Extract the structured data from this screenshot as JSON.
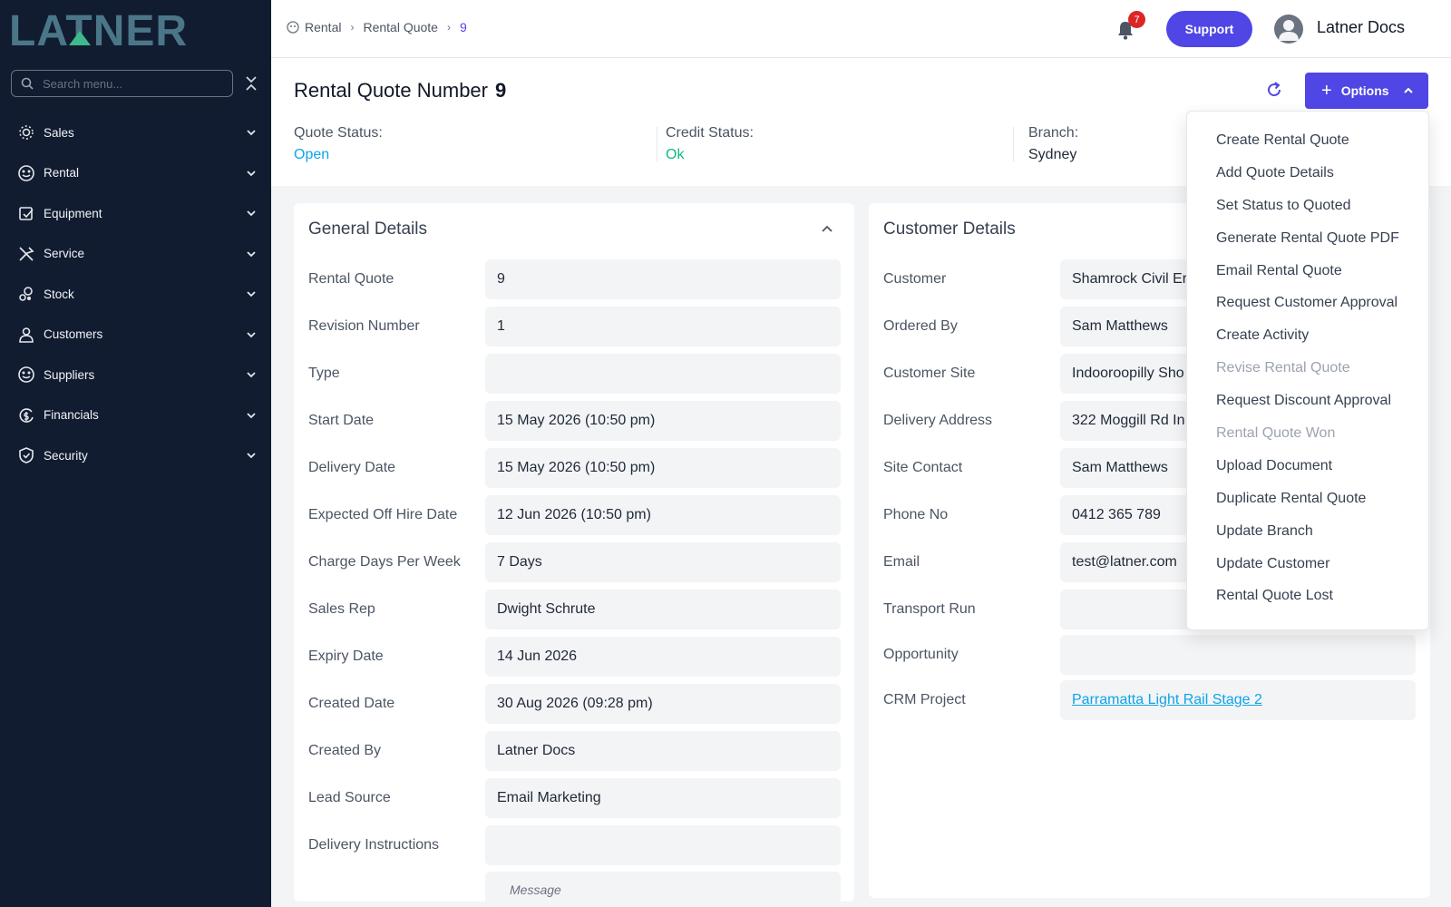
{
  "brand": {
    "logo_text": "LATNER",
    "accent": "#4f46e5",
    "sidebar_bg": "#111c31"
  },
  "sidebar": {
    "search_placeholder": "Search menu...",
    "items": [
      {
        "label": "Sales",
        "icon": "sales-icon"
      },
      {
        "label": "Rental",
        "icon": "rental-icon"
      },
      {
        "label": "Equipment",
        "icon": "equipment-icon"
      },
      {
        "label": "Service",
        "icon": "service-icon"
      },
      {
        "label": "Stock",
        "icon": "stock-icon"
      },
      {
        "label": "Customers",
        "icon": "customers-icon"
      },
      {
        "label": "Suppliers",
        "icon": "suppliers-icon"
      },
      {
        "label": "Financials",
        "icon": "financials-icon"
      },
      {
        "label": "Security",
        "icon": "security-icon"
      }
    ]
  },
  "topbar": {
    "breadcrumb": [
      "Rental",
      "Rental Quote",
      "9"
    ],
    "notification_count": "7",
    "support_label": "Support",
    "user_name": "Latner Docs"
  },
  "header": {
    "title": "Rental Quote Number",
    "number": "9",
    "options_label": "Options",
    "stats": [
      {
        "label": "Quote Status:",
        "value": "Open",
        "color": "#0ea5e9"
      },
      {
        "label": "Credit Status:",
        "value": "Ok",
        "color": "#10b981"
      },
      {
        "label": "Branch:",
        "value": "Sydney",
        "color": "#1f2937"
      }
    ]
  },
  "general": {
    "title": "General Details",
    "rows": [
      {
        "label": "Rental Quote",
        "value": "9"
      },
      {
        "label": "Revision Number",
        "value": "1"
      },
      {
        "label": "Type",
        "value": ""
      },
      {
        "label": "Start Date",
        "value": "15 May 2026 (10:50 pm)"
      },
      {
        "label": "Delivery Date",
        "value": "15 May 2026 (10:50 pm)"
      },
      {
        "label": "Expected Off Hire Date",
        "value": "12 Jun 2026 (10:50 pm)"
      },
      {
        "label": "Charge Days Per Week",
        "value": "7 Days"
      },
      {
        "label": "Sales Rep",
        "value": "Dwight Schrute"
      },
      {
        "label": "Expiry Date",
        "value": "14 Jun 2026"
      },
      {
        "label": "Created Date",
        "value": "30 Aug 2026 (09:28 pm)"
      },
      {
        "label": "Created By",
        "value": "Latner Docs"
      },
      {
        "label": "Lead Source",
        "value": "Email Marketing"
      },
      {
        "label": "Delivery Instructions",
        "value": ""
      }
    ],
    "message_placeholder": "Message"
  },
  "customer": {
    "title": "Customer Details",
    "rows": [
      {
        "label": "Customer",
        "value": "Shamrock Civil Er"
      },
      {
        "label": "Ordered By",
        "value": "Sam Matthews"
      },
      {
        "label": "Customer Site",
        "value": "Indooroopilly Sho"
      },
      {
        "label": "Delivery Address",
        "value": "322 Moggill Rd In"
      },
      {
        "label": "Site Contact",
        "value": "Sam Matthews"
      },
      {
        "label": "Phone No",
        "value": "0412 365 789"
      },
      {
        "label": "Email",
        "value": "test@latner.com"
      },
      {
        "label": "Transport Run",
        "value": ""
      },
      {
        "label": "Opportunity",
        "value": ""
      },
      {
        "label": "CRM Project",
        "value": "Parramatta Light Rail Stage 2"
      }
    ]
  },
  "options_menu": [
    {
      "label": "Create Rental Quote",
      "disabled": false
    },
    {
      "label": "Add Quote Details",
      "disabled": false
    },
    {
      "label": "Set Status to Quoted",
      "disabled": false
    },
    {
      "label": "Generate Rental Quote PDF",
      "disabled": false
    },
    {
      "label": "Email Rental Quote",
      "disabled": false
    },
    {
      "label": "Request Customer Approval",
      "disabled": false
    },
    {
      "label": "Create Activity",
      "disabled": false
    },
    {
      "label": "Revise Rental Quote",
      "disabled": true
    },
    {
      "label": "Request Discount Approval",
      "disabled": false
    },
    {
      "label": "Rental Quote Won",
      "disabled": true
    },
    {
      "label": "Upload Document",
      "disabled": false
    },
    {
      "label": "Duplicate Rental Quote",
      "disabled": false
    },
    {
      "label": "Update Branch",
      "disabled": false
    },
    {
      "label": "Update Customer",
      "disabled": false
    },
    {
      "label": "Rental Quote Lost",
      "disabled": false
    }
  ]
}
